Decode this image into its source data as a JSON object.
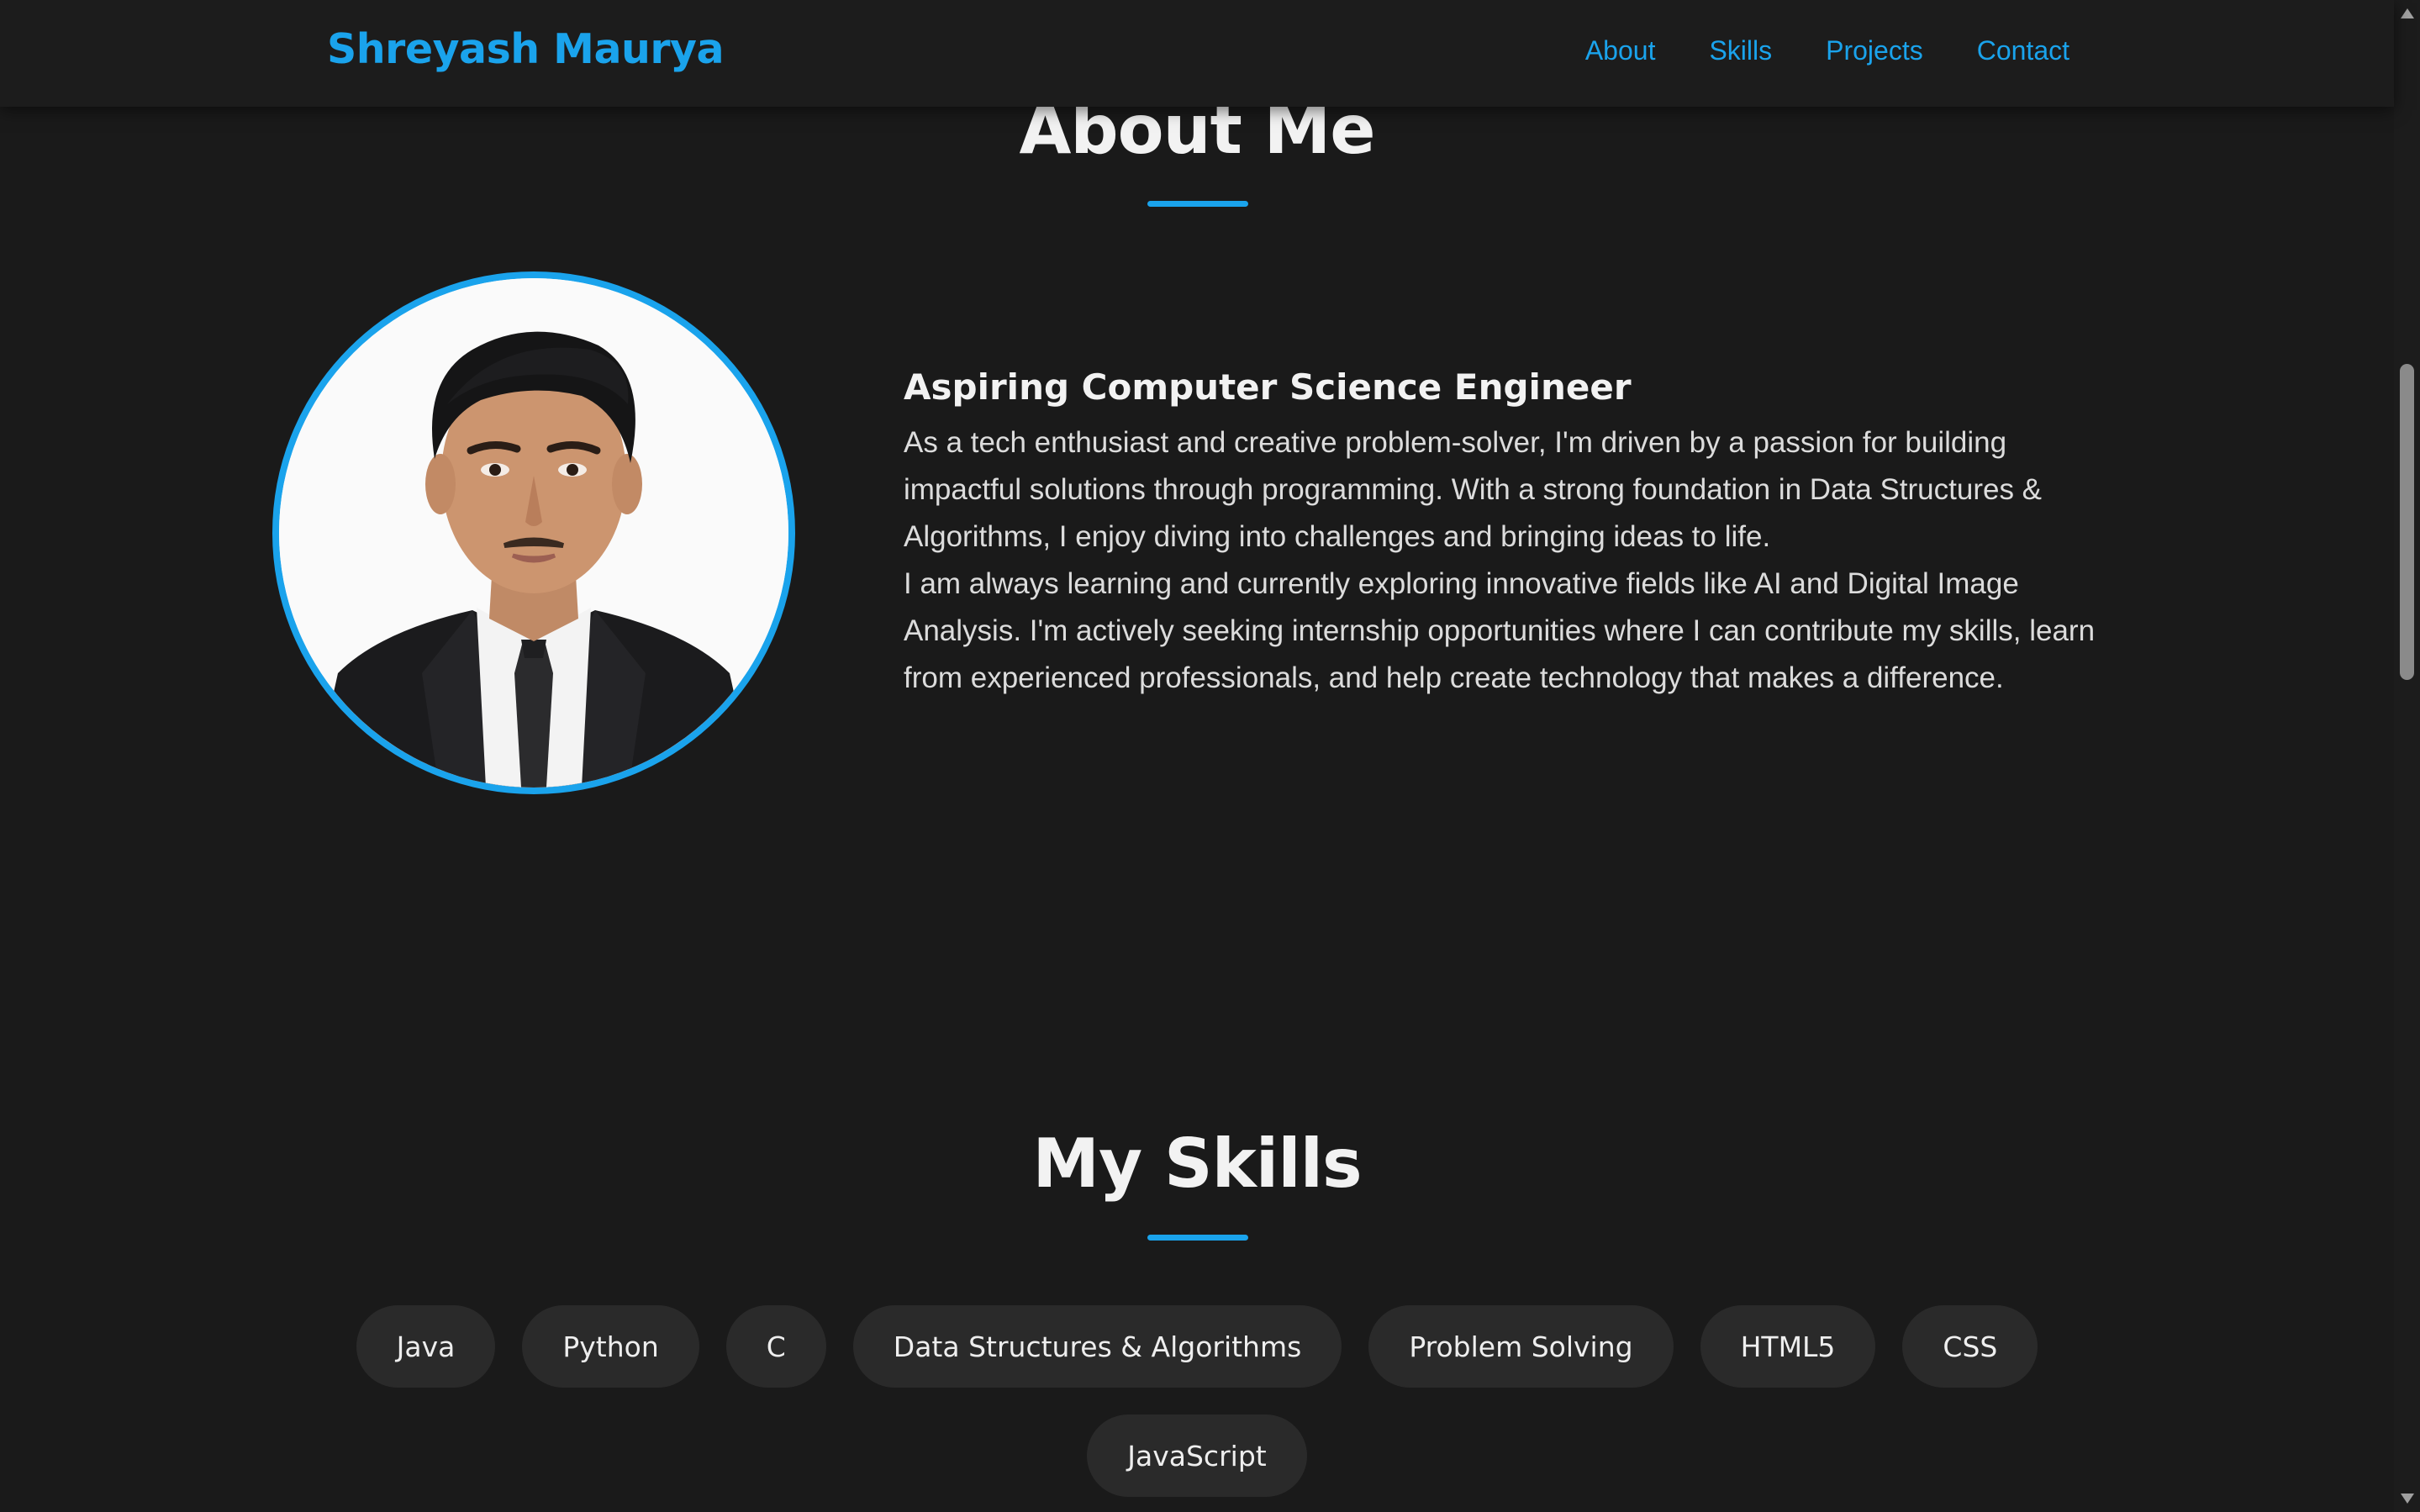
{
  "navbar": {
    "brand": "Shreyash Maurya",
    "links": [
      {
        "label": "About"
      },
      {
        "label": "Skills"
      },
      {
        "label": "Projects"
      },
      {
        "label": "Contact"
      }
    ]
  },
  "about": {
    "title": "About Me",
    "heading": "Aspiring Computer Science Engineer",
    "paragraph_1": "As a tech enthusiast and creative problem-solver, I'm driven by a passion for building impactful solutions through programming. With a strong foundation in Data Structures & Algorithms, I enjoy diving into challenges and bringing ideas to life.",
    "paragraph_2": "I am always learning and currently exploring innovative fields like AI and Digital Image Analysis. I'm actively seeking internship opportunities where I can contribute my skills, learn from experienced professionals, and help create technology that makes a difference.",
    "photo_alt": "profile-photo"
  },
  "skills": {
    "title": "My Skills",
    "items": [
      {
        "label": "Java"
      },
      {
        "label": "Python"
      },
      {
        "label": "C"
      },
      {
        "label": "Data Structures & Algorithms"
      },
      {
        "label": "Problem Solving"
      },
      {
        "label": "HTML5"
      },
      {
        "label": "CSS"
      },
      {
        "label": "JavaScript"
      }
    ]
  },
  "colors": {
    "accent": "#1aa3ec",
    "background": "#1a1a1a",
    "navbar": "#1c1c1c",
    "pill": "#2a2a2a",
    "heading_text": "#f2f2f2",
    "body_text": "#dcdcdc"
  }
}
